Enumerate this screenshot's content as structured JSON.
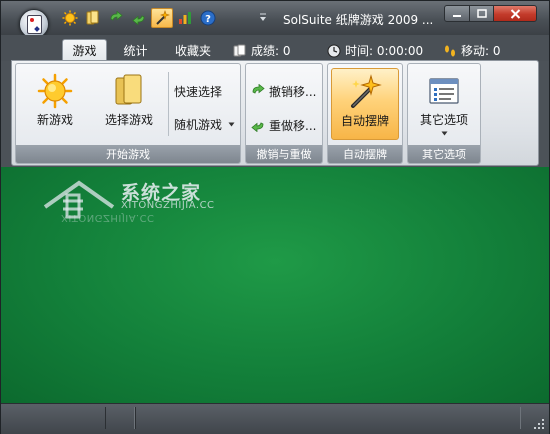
{
  "window": {
    "title": "SolSuite  纸牌游戏 2009 ...",
    "controls": {
      "minimize": "minimize",
      "maximize": "maximize",
      "close": "close"
    }
  },
  "quick_access": [
    {
      "icon": "sun-icon"
    },
    {
      "icon": "cards-icon"
    },
    {
      "icon": "undo-arrow-icon"
    },
    {
      "icon": "redo-arrow-icon"
    },
    {
      "icon": "magic-wand-icon",
      "active": true
    },
    {
      "icon": "stats-chart-icon"
    },
    {
      "icon": "help-icon"
    }
  ],
  "tabs": [
    {
      "label": "游戏",
      "active": true
    },
    {
      "label": "统计",
      "active": false
    },
    {
      "label": "收藏夹",
      "active": false
    }
  ],
  "status": {
    "score": "成绩: 0",
    "time": "时间: 0:00:00",
    "moves": "移动: 0"
  },
  "ribbon": {
    "groups": [
      {
        "label": "开始游戏",
        "big_buttons": [
          "新游戏",
          "选择游戏"
        ],
        "small_buttons": [
          "快速选择",
          "随机游戏"
        ]
      },
      {
        "label": "撤销与重做",
        "small_buttons": [
          "撤销移...",
          "重做移..."
        ]
      },
      {
        "label": "自动摆牌",
        "big_buttons": [
          "自动摆牌"
        ]
      },
      {
        "label": "其它选项",
        "big_buttons": [
          "其它选项"
        ]
      }
    ]
  },
  "watermark": {
    "title": "系统之家",
    "subtitle": "XITONGZHIJIA.CC"
  },
  "colors": {
    "felt": "#13803a",
    "chrome": "#4a5056",
    "highlight": "#ffd27a"
  }
}
